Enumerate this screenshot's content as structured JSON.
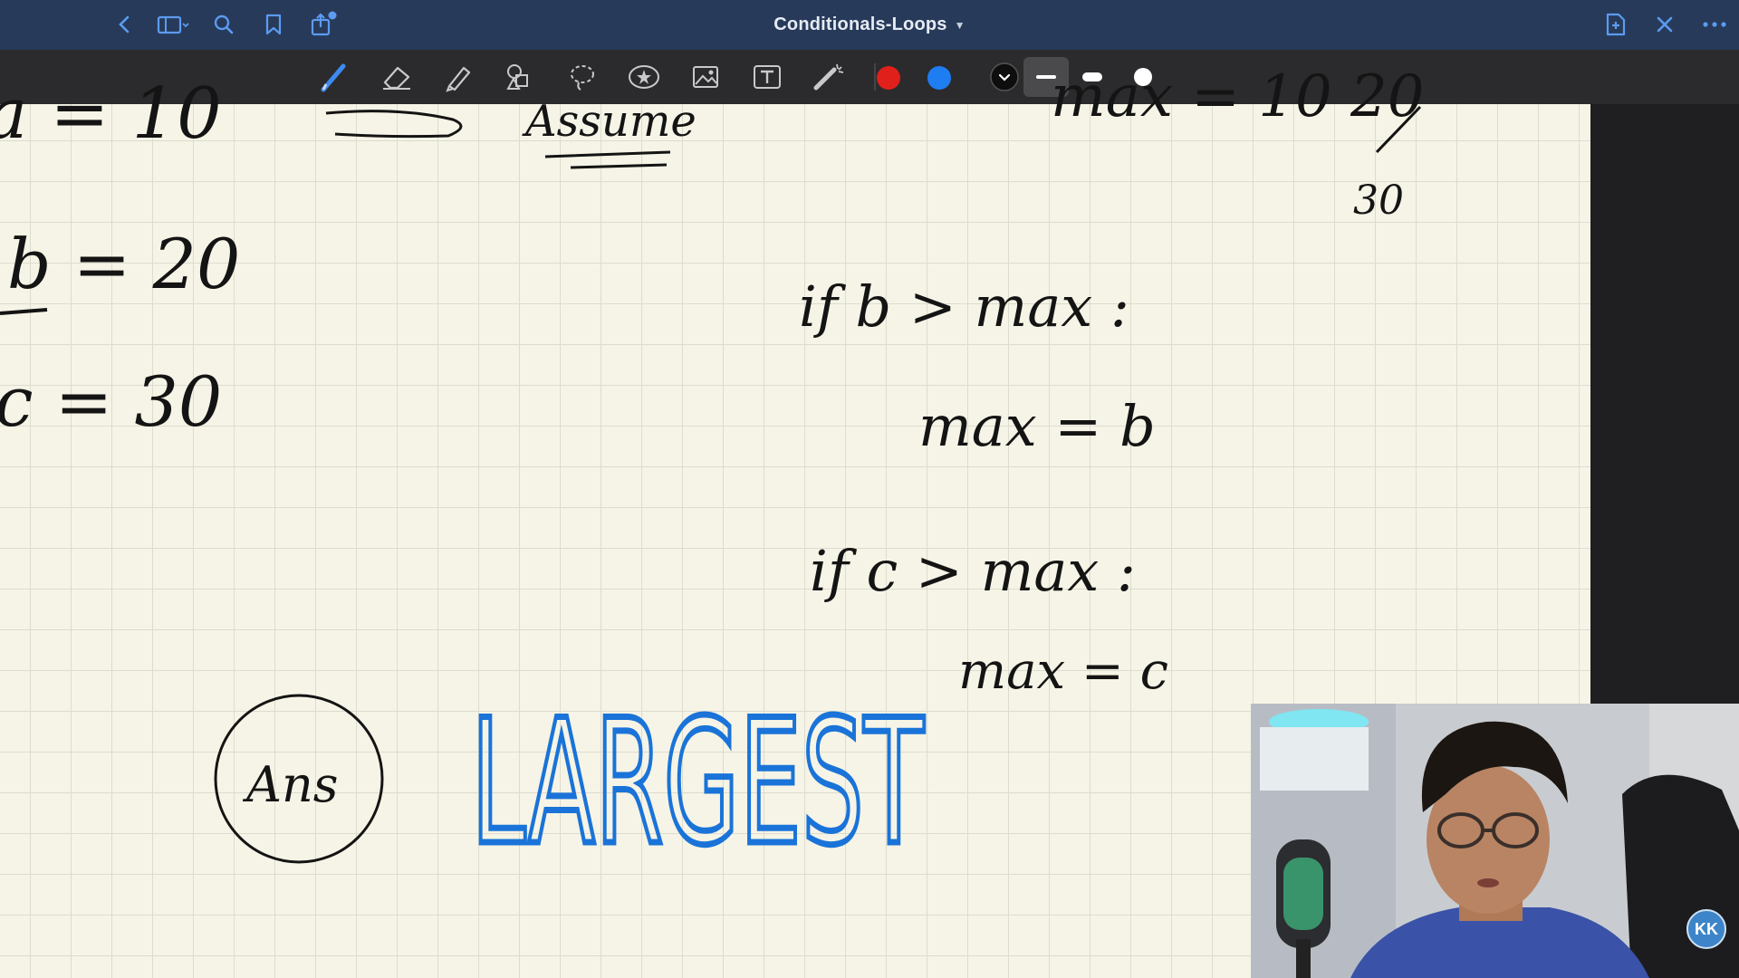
{
  "window": {
    "title": "Conditionals-Loops"
  },
  "titlebar_icons": {
    "left": [
      "back-icon",
      "sidebar-icon",
      "search-icon",
      "bookmark-icon",
      "share-icon"
    ],
    "right": [
      "new-page-icon",
      "close-icon",
      "more-icon"
    ]
  },
  "toolbar": {
    "tools": [
      "pen",
      "eraser",
      "highlighter",
      "shapes",
      "lasso",
      "sticker",
      "image",
      "text",
      "laser-pointer"
    ],
    "colors": [
      "#e0201b",
      "#1f7df2",
      "#111111"
    ],
    "stroke_widths": [
      "thin",
      "medium",
      "thick"
    ]
  },
  "notes": {
    "top_left": "a = 10",
    "assume": "Assume",
    "b_line": "b = 20",
    "c_line": "c = 30",
    "top_right": "max = 10 20",
    "top_right_small": "30",
    "if_b": "if b > max :",
    "assign_b": "max = b",
    "if_c": "if c > max :",
    "assign_c": "max = c",
    "ans": "Ans",
    "largest": "LARGEST"
  },
  "colors": {
    "ink": "#141414",
    "blue_ink": "#1a73d8",
    "paper": "#f6f4e6",
    "titlebar": "#283a5a",
    "toolbar": "#2b2b2d"
  },
  "webcam": {
    "badge": "KK"
  }
}
